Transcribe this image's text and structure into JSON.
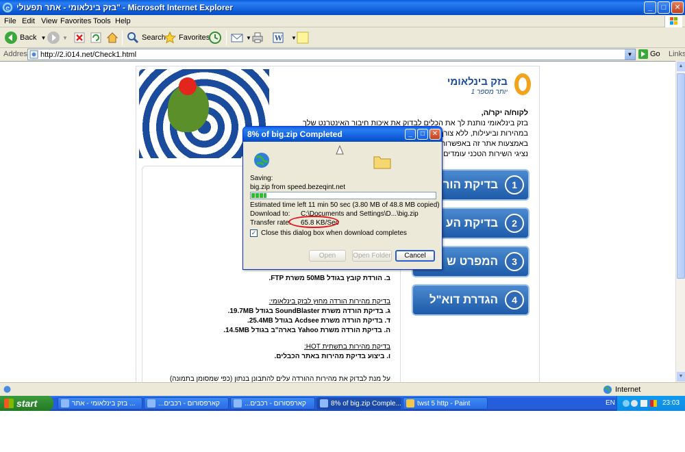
{
  "window": {
    "title": "בזק בינלאומי - אתר תפעולי\" - Microsoft Internet Explorer",
    "buttons": [
      "_",
      "□",
      "✕"
    ]
  },
  "menu": [
    "File",
    "Edit",
    "View",
    "Favorites",
    "Tools",
    "Help"
  ],
  "toolbar": {
    "back_label": "Back",
    "search_label": "Search",
    "favorites_label": "Favorites"
  },
  "address": {
    "label": "Address",
    "url": "http://2.i014.net/Check1.html",
    "go_label": "Go",
    "links_label": "Links"
  },
  "page": {
    "logo_text": "בזק בינלאומי",
    "logo_sub": "יותר מספר 1",
    "greeting": "לקוח/ה יקר/ה,",
    "intro_lines": [
      "בזק בינלאומי נותנת לך את הכלים לבדוק את איכות חיבור האינטרנט שלך",
      "במהירות וביעילות, ללא צורך בפנייה לשירות הלקוחות.",
      "באמצעות אתר זה באפשרותך לבדוק",
      "נציגי השירות הטכני עומדים לשירותך"
    ],
    "panel_lines": [
      "הורדת הקבצים המאוחסנים בשרתים",
      "ה , עלים להכפיל את נתון",
      "על מהירות הגלישה בקירוב."
    ],
    "item_b": "ב.  הורדת קובץ בגודל 50MB משרת FTP.",
    "outside_heading": "בדיקת מהירות הורדה מחוץ לבזק בינלאומי:",
    "item_g": "ג.  בדיקת הורדה משרת SoundBlaster בגודל 19.7MB.",
    "item_d": "ד.  בדיקת הורדה משרת Acdsee בגודל 25.4MB.",
    "item_h": "ה.  בדיקת הורדה משרת Yahoo בארה\"ב בגודל 14.5MB.",
    "hot_heading": "בדיקת מהירות בתשתית HOT:",
    "item_v": "ו.  ביצוע בדיקת מהירות באתר הכבלים.",
    "note_line": "על מנת לבדוק את מהירות ההורדה עלים להתבונן בנתון (כפי שמסומן בתמונה)",
    "nav_buttons": [
      {
        "num": "1",
        "label": "בדיקת הור"
      },
      {
        "num": "2",
        "label": "בדיקת הע"
      },
      {
        "num": "3",
        "label": "המפרט ש"
      },
      {
        "num": "4",
        "label": "הגדרת דוא\"ל"
      }
    ]
  },
  "dialog": {
    "title": "8% of big.zip Completed",
    "saving_label": "Saving:",
    "saving_value": "big.zip from speed.bezeqint.net",
    "progress_fraction": 0.08,
    "eta_line": "Estimated time left  11 min 50 sec (3.80 MB of 48.8 MB copied)",
    "download_to_label": "Download to:",
    "download_to_value": "C:\\Documents and Settings\\D...\\big.zip",
    "rate_label": "Transfer rate:",
    "rate_value": "65.8 KB/Sec",
    "close_checkbox_label": "Close this dialog box when download completes",
    "open_label": "Open",
    "open_folder_label": "Open Folder",
    "cancel_label": "Cancel",
    "accent_color": "#e2141a"
  },
  "status": {
    "zone_label": "Internet"
  },
  "taskbar": {
    "start_label": "start",
    "tasks": [
      "בזק בינלאומי - אתר ...",
      "...קארפסורום - רכבים",
      "...קארפסורום - רכבים",
      "8% of big.zip Comple...",
      "twst 5 http - Paint"
    ],
    "lang": "EN",
    "clock": "23:03"
  }
}
